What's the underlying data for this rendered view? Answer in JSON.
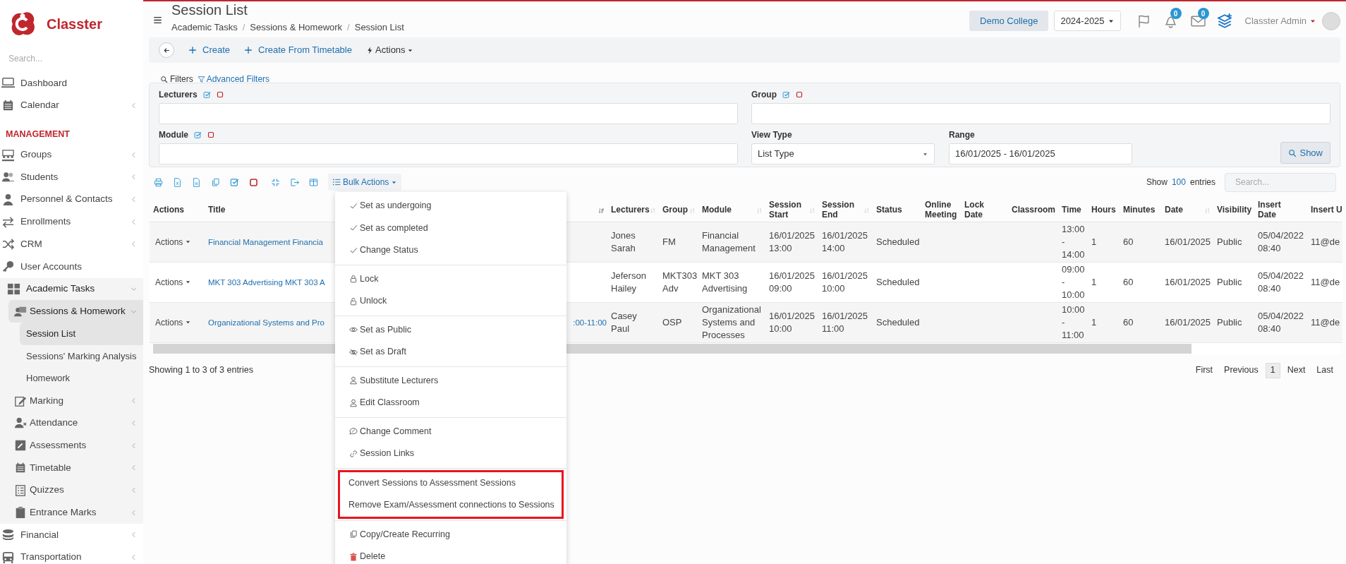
{
  "sidebar": {
    "brand": "Classter",
    "search": {
      "placeholder": "Search..."
    },
    "items": [
      {
        "kind": "link",
        "label": "Dashboard"
      },
      {
        "kind": "menu",
        "label": "Calendar",
        "expanded": false
      },
      {
        "kind": "heading",
        "label": "MANAGEMENT"
      },
      {
        "kind": "menu",
        "label": "Groups",
        "expanded": false
      },
      {
        "kind": "menu",
        "label": "Students",
        "expanded": false
      },
      {
        "kind": "menu",
        "label": "Personnel & Contacts",
        "expanded": false
      },
      {
        "kind": "menu",
        "label": "Enrollments",
        "expanded": false
      },
      {
        "kind": "menu",
        "label": "CRM",
        "expanded": false
      },
      {
        "kind": "link",
        "label": "User Accounts"
      },
      {
        "kind": "menu",
        "label": "Academic Tasks",
        "expanded": true,
        "children": [
          {
            "kind": "menu",
            "label": "Sessions & Homework",
            "expanded": true,
            "children": [
              {
                "kind": "link",
                "label": "Session List",
                "selected": true
              },
              {
                "kind": "link",
                "label": "Sessions' Marking Analysis",
                "selected": false
              },
              {
                "kind": "link",
                "label": "Homework",
                "selected": false
              }
            ]
          },
          {
            "kind": "menu",
            "label": "Marking",
            "expanded": false
          },
          {
            "kind": "menu",
            "label": "Attendance",
            "expanded": false
          },
          {
            "kind": "menu",
            "label": "Assessments",
            "expanded": false
          },
          {
            "kind": "menu",
            "label": "Timetable",
            "expanded": false
          },
          {
            "kind": "menu",
            "label": "Quizzes",
            "expanded": false
          },
          {
            "kind": "menu",
            "label": "Entrance Marks",
            "expanded": false
          }
        ]
      },
      {
        "kind": "menu",
        "label": "Financial",
        "expanded": false
      },
      {
        "kind": "menu",
        "label": "Transportation",
        "expanded": false
      }
    ]
  },
  "header": {
    "title": "Session List",
    "breadcrumb_separator": "/",
    "breadcrumb": [
      "Academic Tasks",
      "Sessions & Homework",
      "Session List"
    ],
    "college": "Demo College",
    "year": "2024-2025",
    "notifications": "0",
    "messages": "0",
    "user": "Classter Admin"
  },
  "toolbar": {
    "buttons": [
      {
        "kind": "create",
        "label": "Create"
      },
      {
        "kind": "create",
        "label": "Create From Timetable"
      },
      {
        "kind": "menu",
        "label": "Actions"
      }
    ]
  },
  "filters": {
    "title": "Filters",
    "advanced": "Advanced Filters",
    "fields": [
      {
        "kind": "multi",
        "label": "Lecturers"
      },
      {
        "kind": "multi",
        "label": "Group"
      },
      {
        "kind": "multi",
        "label": "Module"
      },
      {
        "kind": "select",
        "label": "View Type",
        "value": "List Type"
      },
      {
        "kind": "text",
        "label": "Range",
        "value": "16/01/2025 - 16/01/2025"
      }
    ],
    "show_button": "Show"
  },
  "table_toolbar": {
    "bulk_actions": "Bulk Actions",
    "page_length": {
      "prefix": "Show",
      "value": "100",
      "suffix": "entries"
    },
    "search": {
      "placeholder": "Search..."
    }
  },
  "table": {
    "columns": [
      {
        "label": "Actions",
        "sortable": false,
        "sorted": false
      },
      {
        "label": "Title",
        "sortable": false,
        "sorted": false
      },
      {
        "sortable": true,
        "sorted": true
      },
      {
        "label": "Lecturers",
        "sortable": true,
        "sorted": false
      },
      {
        "label": "Group",
        "sortable": true,
        "sorted": false
      },
      {
        "label": "Module",
        "sortable": true,
        "sorted": false
      },
      {
        "label": "Session Start",
        "sortable": true,
        "sorted": false
      },
      {
        "label": "Session End",
        "sortable": true,
        "sorted": false
      },
      {
        "label": "Status",
        "sortable": false,
        "sorted": false
      },
      {
        "label": "Online Meeting",
        "sortable": false,
        "sorted": false
      },
      {
        "label": "Lock Date",
        "sortable": false,
        "sorted": false
      },
      {
        "label": "Classroom",
        "sortable": false,
        "sorted": false
      },
      {
        "label": "Time",
        "sortable": false,
        "sorted": false
      },
      {
        "label": "Hours",
        "sortable": false,
        "sorted": false
      },
      {
        "label": "Minutes",
        "sortable": false,
        "sorted": false
      },
      {
        "label": "Date",
        "sortable": true,
        "sorted": false
      },
      {
        "label": "Visibility",
        "sortable": false,
        "sorted": false
      },
      {
        "label": "Insert Date",
        "sortable": false,
        "sorted": false
      },
      {
        "label": "Insert U",
        "sortable": false,
        "sorted": false
      }
    ],
    "rows": [
      {
        "actions": "Actions",
        "title": "Financial Management Financia",
        "lecturers": "Jones Sarah",
        "group": "FM",
        "module": "Financial Management",
        "session_start": "16/01/2025 13:00",
        "session_end": "16/01/2025 14:00",
        "status": "Scheduled",
        "time": "13:00 - 14:00",
        "hours": "1",
        "minutes": "60",
        "date": "16/01/2025",
        "visibility": "Public",
        "insert_date": "05/04/2022 08:40",
        "insert_u": "11@de"
      },
      {
        "actions": "Actions",
        "title": "MKT 303 Advertising MKT 303 A",
        "lecturers": "Jeferson Hailey",
        "group": "MKT303 Adv",
        "module": "MKT 303 Advertising",
        "session_start": "16/01/2025 09:00",
        "session_end": "16/01/2025 10:00",
        "status": "Scheduled",
        "time": "09:00 - 10:00",
        "hours": "1",
        "minutes": "60",
        "date": "16/01/2025",
        "visibility": "Public",
        "insert_date": "05/04/2022 08:40",
        "insert_u": "11@de"
      },
      {
        "actions": "Actions",
        "title": "Organizational Systems and Pro",
        "column_3": ":00-11:00",
        "lecturers": "Casey Paul",
        "group": "OSP",
        "module": "Organizational Systems and Processes",
        "session_start": "16/01/2025 10:00",
        "session_end": "16/01/2025 11:00",
        "status": "Scheduled",
        "time": "10:00 - 11:00",
        "hours": "1",
        "minutes": "60",
        "date": "16/01/2025",
        "visibility": "Public",
        "insert_date": "05/04/2022 08:40",
        "insert_u": "11@de"
      }
    ],
    "info": "Showing 1 to 3 of 3 entries",
    "pagination": [
      {
        "label": "First",
        "selected": false
      },
      {
        "label": "Previous",
        "selected": false
      },
      {
        "label": "1",
        "selected": true
      },
      {
        "label": "Next",
        "selected": false
      },
      {
        "label": "Last",
        "selected": false
      }
    ]
  },
  "bulk_menu": {
    "groups": [
      {
        "highlighted": false,
        "items": [
          "Set as undergoing",
          "Set as completed",
          "Change Status"
        ]
      },
      {
        "highlighted": false,
        "items": [
          "Lock",
          "Unlock"
        ]
      },
      {
        "highlighted": false,
        "items": [
          "Set as Public",
          "Set as Draft"
        ]
      },
      {
        "highlighted": false,
        "items": [
          "Substitute Lecturers",
          "Edit Classroom"
        ]
      },
      {
        "highlighted": false,
        "items": [
          "Change Comment",
          "Session Links"
        ]
      },
      {
        "highlighted": true,
        "items": [
          "Convert Sessions to Assessment Sessions",
          "Remove Exam/Assessment connections to Sessions"
        ]
      },
      {
        "highlighted": false,
        "items": [
          "Copy/Create Recurring",
          "Delete"
        ]
      }
    ]
  }
}
